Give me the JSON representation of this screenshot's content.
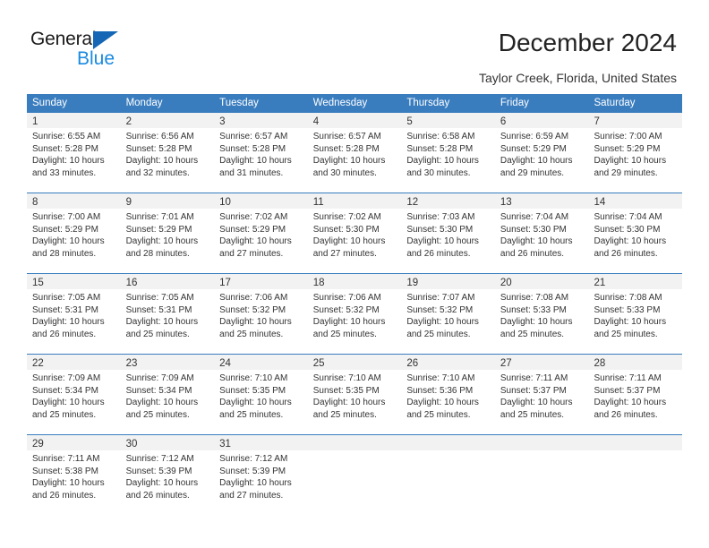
{
  "brand": {
    "name_top": "General",
    "name_bottom": "Blue",
    "accent_color": "#1a8ae0",
    "triangle_color": "#1567b5"
  },
  "header": {
    "title": "December 2024",
    "subtitle": "Taylor Creek, Florida, United States"
  },
  "theme": {
    "header_band": "#3a7dbf",
    "day_band": "#f2f2f2",
    "text": "#333333"
  },
  "weekdays": [
    "Sunday",
    "Monday",
    "Tuesday",
    "Wednesday",
    "Thursday",
    "Friday",
    "Saturday"
  ],
  "weeks": [
    [
      {
        "day": "1",
        "lines": [
          "Sunrise: 6:55 AM",
          "Sunset: 5:28 PM",
          "Daylight: 10 hours",
          "and 33 minutes."
        ]
      },
      {
        "day": "2",
        "lines": [
          "Sunrise: 6:56 AM",
          "Sunset: 5:28 PM",
          "Daylight: 10 hours",
          "and 32 minutes."
        ]
      },
      {
        "day": "3",
        "lines": [
          "Sunrise: 6:57 AM",
          "Sunset: 5:28 PM",
          "Daylight: 10 hours",
          "and 31 minutes."
        ]
      },
      {
        "day": "4",
        "lines": [
          "Sunrise: 6:57 AM",
          "Sunset: 5:28 PM",
          "Daylight: 10 hours",
          "and 30 minutes."
        ]
      },
      {
        "day": "5",
        "lines": [
          "Sunrise: 6:58 AM",
          "Sunset: 5:28 PM",
          "Daylight: 10 hours",
          "and 30 minutes."
        ]
      },
      {
        "day": "6",
        "lines": [
          "Sunrise: 6:59 AM",
          "Sunset: 5:29 PM",
          "Daylight: 10 hours",
          "and 29 minutes."
        ]
      },
      {
        "day": "7",
        "lines": [
          "Sunrise: 7:00 AM",
          "Sunset: 5:29 PM",
          "Daylight: 10 hours",
          "and 29 minutes."
        ]
      }
    ],
    [
      {
        "day": "8",
        "lines": [
          "Sunrise: 7:00 AM",
          "Sunset: 5:29 PM",
          "Daylight: 10 hours",
          "and 28 minutes."
        ]
      },
      {
        "day": "9",
        "lines": [
          "Sunrise: 7:01 AM",
          "Sunset: 5:29 PM",
          "Daylight: 10 hours",
          "and 28 minutes."
        ]
      },
      {
        "day": "10",
        "lines": [
          "Sunrise: 7:02 AM",
          "Sunset: 5:29 PM",
          "Daylight: 10 hours",
          "and 27 minutes."
        ]
      },
      {
        "day": "11",
        "lines": [
          "Sunrise: 7:02 AM",
          "Sunset: 5:30 PM",
          "Daylight: 10 hours",
          "and 27 minutes."
        ]
      },
      {
        "day": "12",
        "lines": [
          "Sunrise: 7:03 AM",
          "Sunset: 5:30 PM",
          "Daylight: 10 hours",
          "and 26 minutes."
        ]
      },
      {
        "day": "13",
        "lines": [
          "Sunrise: 7:04 AM",
          "Sunset: 5:30 PM",
          "Daylight: 10 hours",
          "and 26 minutes."
        ]
      },
      {
        "day": "14",
        "lines": [
          "Sunrise: 7:04 AM",
          "Sunset: 5:30 PM",
          "Daylight: 10 hours",
          "and 26 minutes."
        ]
      }
    ],
    [
      {
        "day": "15",
        "lines": [
          "Sunrise: 7:05 AM",
          "Sunset: 5:31 PM",
          "Daylight: 10 hours",
          "and 26 minutes."
        ]
      },
      {
        "day": "16",
        "lines": [
          "Sunrise: 7:05 AM",
          "Sunset: 5:31 PM",
          "Daylight: 10 hours",
          "and 25 minutes."
        ]
      },
      {
        "day": "17",
        "lines": [
          "Sunrise: 7:06 AM",
          "Sunset: 5:32 PM",
          "Daylight: 10 hours",
          "and 25 minutes."
        ]
      },
      {
        "day": "18",
        "lines": [
          "Sunrise: 7:06 AM",
          "Sunset: 5:32 PM",
          "Daylight: 10 hours",
          "and 25 minutes."
        ]
      },
      {
        "day": "19",
        "lines": [
          "Sunrise: 7:07 AM",
          "Sunset: 5:32 PM",
          "Daylight: 10 hours",
          "and 25 minutes."
        ]
      },
      {
        "day": "20",
        "lines": [
          "Sunrise: 7:08 AM",
          "Sunset: 5:33 PM",
          "Daylight: 10 hours",
          "and 25 minutes."
        ]
      },
      {
        "day": "21",
        "lines": [
          "Sunrise: 7:08 AM",
          "Sunset: 5:33 PM",
          "Daylight: 10 hours",
          "and 25 minutes."
        ]
      }
    ],
    [
      {
        "day": "22",
        "lines": [
          "Sunrise: 7:09 AM",
          "Sunset: 5:34 PM",
          "Daylight: 10 hours",
          "and 25 minutes."
        ]
      },
      {
        "day": "23",
        "lines": [
          "Sunrise: 7:09 AM",
          "Sunset: 5:34 PM",
          "Daylight: 10 hours",
          "and 25 minutes."
        ]
      },
      {
        "day": "24",
        "lines": [
          "Sunrise: 7:10 AM",
          "Sunset: 5:35 PM",
          "Daylight: 10 hours",
          "and 25 minutes."
        ]
      },
      {
        "day": "25",
        "lines": [
          "Sunrise: 7:10 AM",
          "Sunset: 5:35 PM",
          "Daylight: 10 hours",
          "and 25 minutes."
        ]
      },
      {
        "day": "26",
        "lines": [
          "Sunrise: 7:10 AM",
          "Sunset: 5:36 PM",
          "Daylight: 10 hours",
          "and 25 minutes."
        ]
      },
      {
        "day": "27",
        "lines": [
          "Sunrise: 7:11 AM",
          "Sunset: 5:37 PM",
          "Daylight: 10 hours",
          "and 25 minutes."
        ]
      },
      {
        "day": "28",
        "lines": [
          "Sunrise: 7:11 AM",
          "Sunset: 5:37 PM",
          "Daylight: 10 hours",
          "and 26 minutes."
        ]
      }
    ],
    [
      {
        "day": "29",
        "lines": [
          "Sunrise: 7:11 AM",
          "Sunset: 5:38 PM",
          "Daylight: 10 hours",
          "and 26 minutes."
        ]
      },
      {
        "day": "30",
        "lines": [
          "Sunrise: 7:12 AM",
          "Sunset: 5:39 PM",
          "Daylight: 10 hours",
          "and 26 minutes."
        ]
      },
      {
        "day": "31",
        "lines": [
          "Sunrise: 7:12 AM",
          "Sunset: 5:39 PM",
          "Daylight: 10 hours",
          "and 27 minutes."
        ]
      },
      {
        "day": "",
        "lines": []
      },
      {
        "day": "",
        "lines": []
      },
      {
        "day": "",
        "lines": []
      },
      {
        "day": "",
        "lines": []
      }
    ]
  ]
}
